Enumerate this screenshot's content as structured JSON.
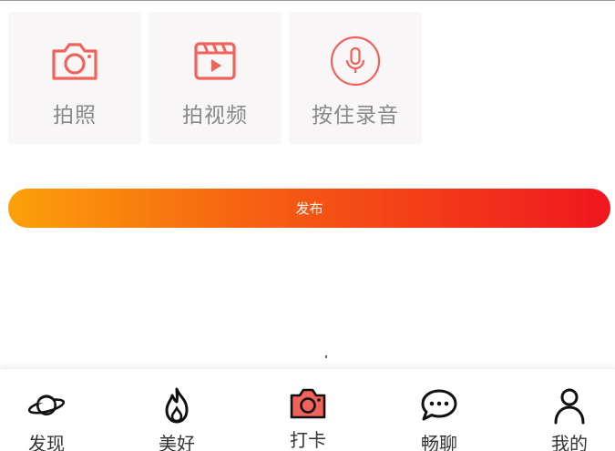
{
  "actions": [
    {
      "label": "拍照",
      "icon": "camera-icon"
    },
    {
      "label": "拍视频",
      "icon": "video-clapper-icon"
    },
    {
      "label": "按住录音",
      "icon": "microphone-icon"
    }
  ],
  "publish": {
    "label": "发布"
  },
  "tabbar": {
    "items": [
      {
        "label": "发现",
        "icon": "planet-icon"
      },
      {
        "label": "美好",
        "icon": "flame-icon"
      },
      {
        "label": "打卡",
        "icon": "camera-icon",
        "active": true
      },
      {
        "label": "畅聊",
        "icon": "chat-bubble-icon"
      },
      {
        "label": "我的",
        "icon": "user-icon"
      }
    ]
  },
  "colors": {
    "accent": "#f0625a",
    "gradient_start": "#fba10a",
    "gradient_end": "#f0161f",
    "tile_bg": "#f8f6f6"
  }
}
